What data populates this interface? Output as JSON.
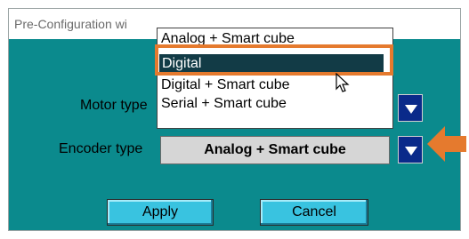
{
  "window": {
    "title": "Pre-Configuration wi"
  },
  "form": {
    "motor_type_label": "Motor type",
    "encoder_type_label": "Encoder type",
    "encoder_type_value": "Analog + Smart cube"
  },
  "dropdown": {
    "options": [
      "Analog + Smart cube",
      "Digital",
      "Digital + Smart cube",
      "Serial + Smart cube"
    ],
    "selected": "Digital"
  },
  "buttons": {
    "apply": "Apply",
    "cancel": "Cancel"
  },
  "colors": {
    "window_bg": "#0b8a8d",
    "highlight": "#e57a2e",
    "combo_button": "#0a2a8a",
    "button_face": "#39c3e0"
  },
  "icons": [
    "mouse-pointer-icon",
    "chevron-down-icon",
    "callout-arrow-icon"
  ]
}
